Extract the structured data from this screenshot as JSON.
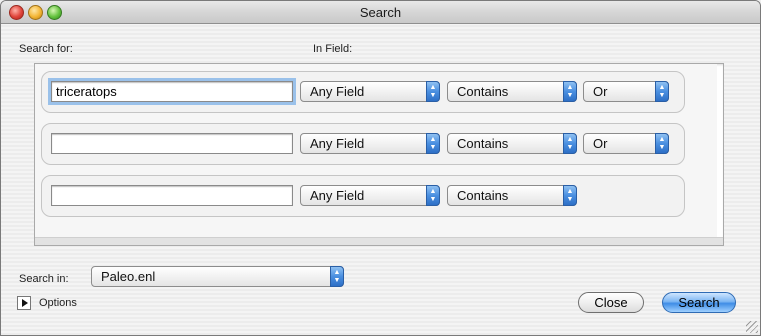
{
  "window": {
    "title": "Search"
  },
  "labels": {
    "search_for": "Search for:",
    "in_field": "In Field:",
    "search_in": "Search in:",
    "options": "Options"
  },
  "criteria": [
    {
      "value": "triceratops",
      "field": "Any Field",
      "match": "Contains",
      "bool": "Or"
    },
    {
      "value": "",
      "field": "Any Field",
      "match": "Contains",
      "bool": "Or"
    },
    {
      "value": "",
      "field": "Any Field",
      "match": "Contains"
    }
  ],
  "search_in": {
    "selected": "Paleo.enl"
  },
  "buttons": {
    "close": "Close",
    "search": "Search"
  },
  "colors": {
    "accent": "#4a8fe0",
    "focus_ring": "#9ac1ea"
  },
  "icons": {
    "popup_arrow": "updown-arrows-icon",
    "options_disclosure": "disclosure-triangle-icon"
  }
}
